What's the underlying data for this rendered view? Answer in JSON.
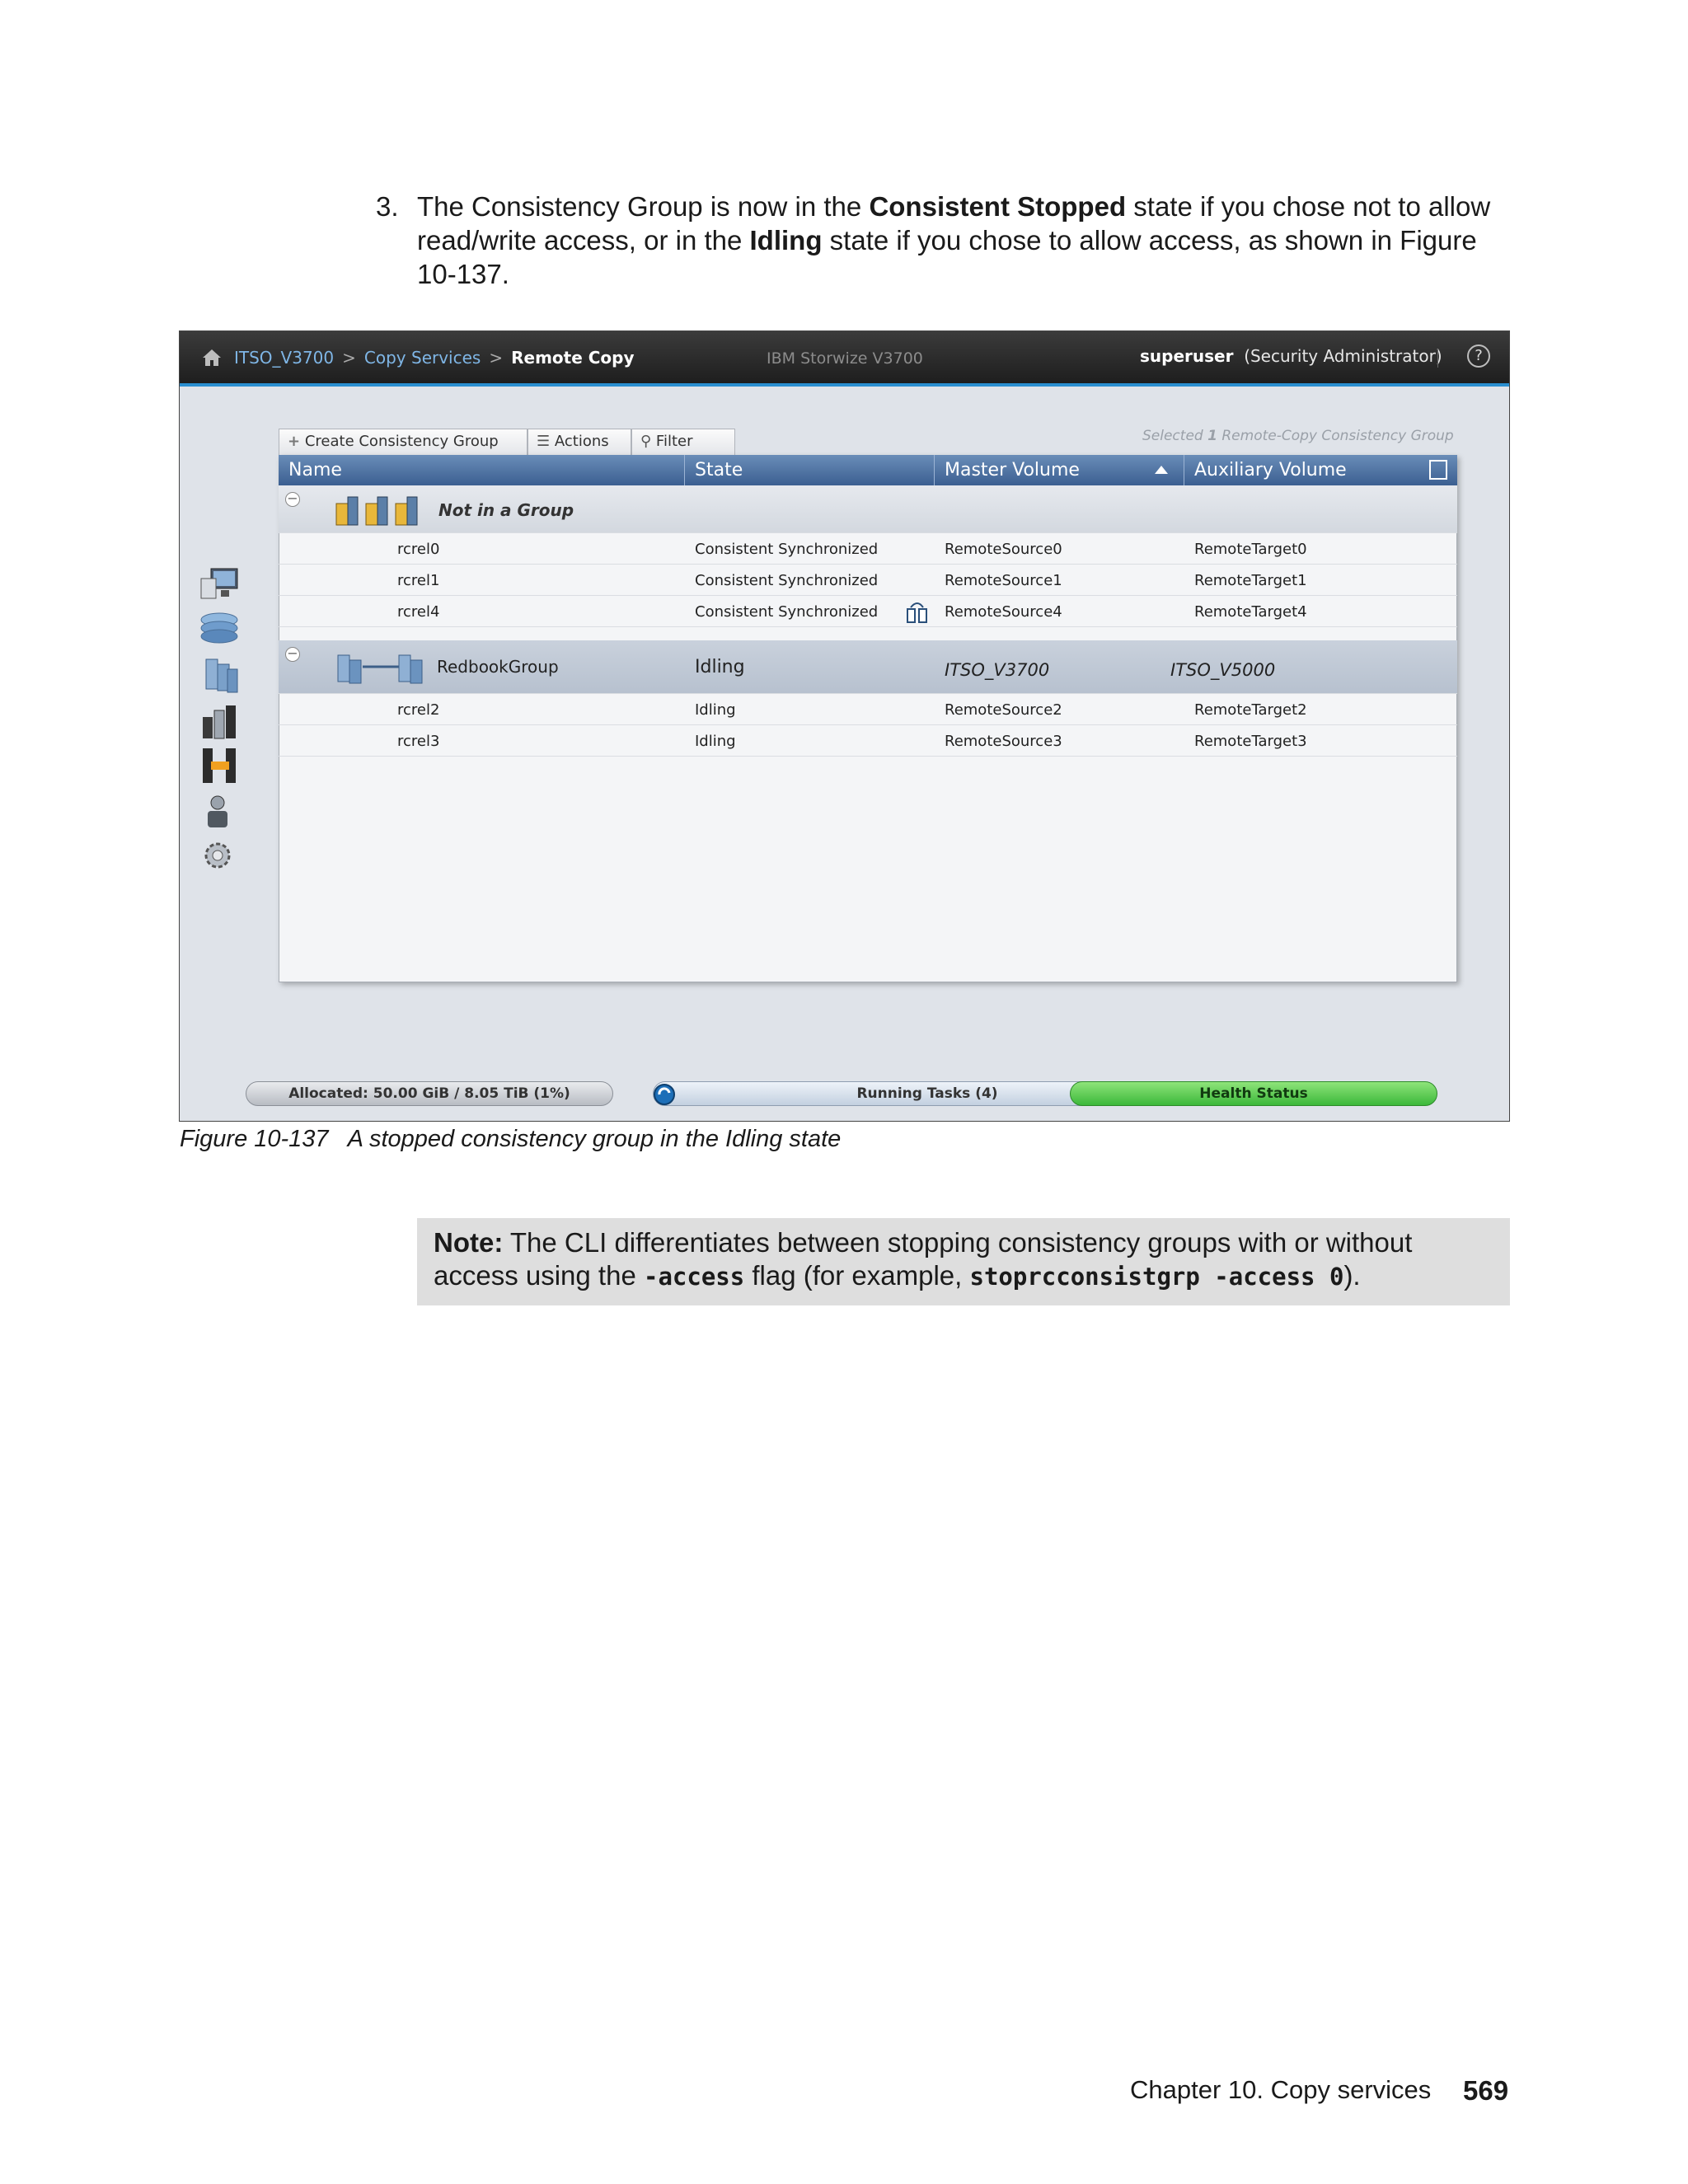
{
  "step": {
    "number": "3.",
    "t1": "The Consistency Group is now in the ",
    "b1": "Consistent Stopped",
    "t2": " state if you chose not to allow read/write access, or in the ",
    "b2": "Idling",
    "t3": " state if you chose to allow access, as shown in Figure 10-137."
  },
  "screenshot": {
    "breadcrumb": [
      "ITSO_V3700",
      "Copy Services",
      "Remote Copy"
    ],
    "breadcrumb_sep": ">",
    "product": "IBM Storwize V3700",
    "user": "superuser",
    "role": "(Security Administrator)",
    "help": "?",
    "toolbar": {
      "create": "Create Consistency Group",
      "actions": "Actions",
      "filter": "Filter"
    },
    "selected_prefix": "Selected ",
    "selected_count": "1",
    "selected_suffix": " Remote-Copy Consistency Group",
    "columns": [
      "Name",
      "State",
      "Master Volume",
      "Auxiliary Volume"
    ],
    "group1": {
      "name": "Not in a Group",
      "rows": [
        {
          "name": "rcrel0",
          "state": "Consistent Synchronized",
          "master": "RemoteSource0",
          "aux": "RemoteTarget0"
        },
        {
          "name": "rcrel1",
          "state": "Consistent Synchronized",
          "master": "RemoteSource1",
          "aux": "RemoteTarget1"
        },
        {
          "name": "rcrel4",
          "state": "Consistent Synchronized",
          "master": "RemoteSource4",
          "aux": "RemoteTarget4"
        }
      ]
    },
    "group2": {
      "name": "RedbookGroup",
      "state": "Idling",
      "master": "ITSO_V3700",
      "aux": "ITSO_V5000",
      "rows": [
        {
          "name": "rcrel2",
          "state": "Idling",
          "master": "RemoteSource2",
          "aux": "RemoteTarget2"
        },
        {
          "name": "rcrel3",
          "state": "Idling",
          "master": "RemoteSource3",
          "aux": "RemoteTarget3"
        }
      ]
    },
    "status": {
      "allocated": "Allocated: 50.00 GiB / 8.05 TiB (1%)",
      "tasks": "Running Tasks (4)",
      "health": "Health Status"
    },
    "colors": {
      "accent": "#2a8fd0",
      "header": "#3b5f91",
      "health": "#3cb83a"
    }
  },
  "caption": "Figure 10-137   A stopped consistency group in the Idling state",
  "note": {
    "label": "Note:",
    "t1": " The CLI differentiates between stopping consistency groups with or without access using the ",
    "flag": "-access",
    "t2": "  flag (for example, ",
    "cmd": "stoprcconsistgrp -access 0",
    "t3": ")."
  },
  "footer": {
    "chapter": "Chapter 10. Copy services",
    "page": "569"
  }
}
